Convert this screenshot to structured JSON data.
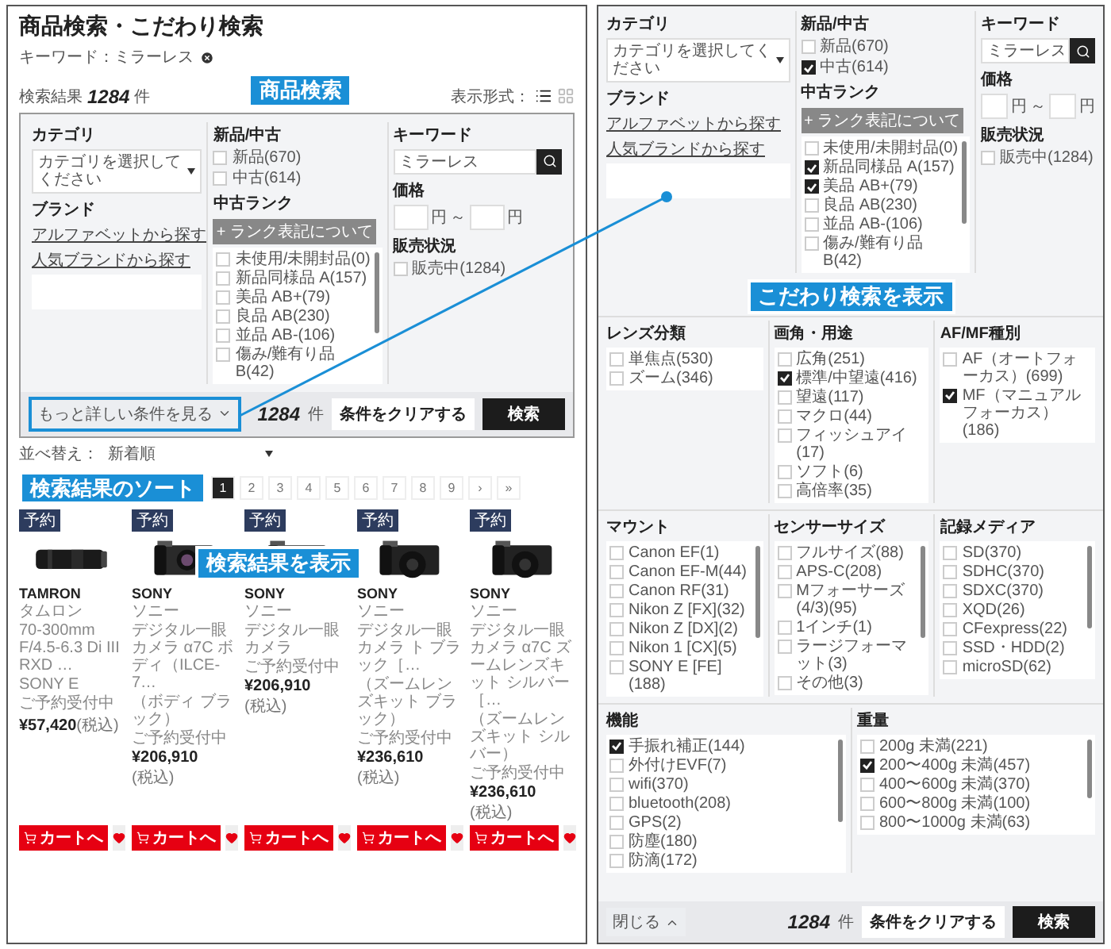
{
  "left": {
    "title": "商品検索・こだわり検索",
    "keyword_tag": "キーワード：ミラーレス",
    "result": {
      "label": "検索結果",
      "count": "1284",
      "unit": "件"
    },
    "view": {
      "label": "表示形式：",
      "modes": [
        {
          "kind": "list",
          "selected": true
        },
        {
          "kind": "grid",
          "selected": false
        }
      ]
    },
    "search": {
      "category": {
        "label": "カテゴリ",
        "placeholder": "カテゴリを選択してください"
      },
      "brand": {
        "label": "ブランド",
        "links": [
          "アルファベットから探す",
          "人気ブランドから探す"
        ]
      },
      "condition": {
        "label": "新品/中古",
        "options": [
          {
            "label": "新品(670)",
            "checked": false
          },
          {
            "label": "中古(614)",
            "checked": false
          }
        ]
      },
      "rank": {
        "label": "中古ランク",
        "help": "+ ランク表記について",
        "options": [
          {
            "label": "未使用/未開封品(0)",
            "checked": false
          },
          {
            "label": "新品同様品 A(157)",
            "checked": false
          },
          {
            "label": "美品 AB+(79)",
            "checked": false
          },
          {
            "label": "良品 AB(230)",
            "checked": false
          },
          {
            "label": "並品 AB-(106)",
            "checked": false
          },
          {
            "label": "傷み/難有り品 B(42)",
            "checked": false
          }
        ]
      },
      "keyword": {
        "label": "キーワード",
        "value": "ミラーレス"
      },
      "price": {
        "label": "価格",
        "min_unit": "円",
        "separator": "～",
        "max_unit": "円"
      },
      "status": {
        "label": "販売状況",
        "options": [
          {
            "label": "販売中(1284)",
            "checked": false
          }
        ]
      }
    },
    "footer": {
      "toggle": "もっと詳しい条件を見る",
      "expanded": false,
      "count": "1284",
      "unit": "件",
      "clear": "条件をクリアする",
      "submit": "検索"
    },
    "sort": {
      "label": "並べ替え：",
      "value": "新着順"
    },
    "pages": [
      {
        "label": "1",
        "selected": true
      },
      {
        "label": "2",
        "selected": false
      },
      {
        "label": "3",
        "selected": false
      },
      {
        "label": "4",
        "selected": false
      },
      {
        "label": "5",
        "selected": false
      },
      {
        "label": "6",
        "selected": false
      },
      {
        "label": "7",
        "selected": false
      },
      {
        "label": "8",
        "selected": false
      },
      {
        "label": "9",
        "selected": false
      },
      {
        "label": "›",
        "selected": false
      },
      {
        "label": "»",
        "selected": false
      }
    ],
    "products": [
      {
        "kind": "lens",
        "badge": "予約",
        "brand": "TAMRON",
        "brand_kana": "タムロン",
        "name": "70-300mm F/4.5-6.3 Di III RXD …",
        "note": "SONY E",
        "status": "ご予約受付中",
        "price": "¥57,420",
        "tax": "(税込)",
        "cart": "カートへ"
      },
      {
        "kind": "camera",
        "badge": "予約",
        "brand": "SONY",
        "brand_kana": "ソニー",
        "name": "デジタル一眼カメラ α7C ボディ（ILCE-7…",
        "note": "（ボディ ブラック）",
        "status": "ご予約受付中",
        "price": "¥206,910",
        "tax": "(税込)",
        "cart": "カートへ"
      },
      {
        "kind": "camera",
        "badge": "予約",
        "brand": "SONY",
        "brand_kana": "ソニー",
        "name": "デジタル一眼カメラ",
        "status": "ご予約受付中",
        "price": "¥206,910",
        "tax": "(税込)",
        "cart": "カートへ"
      },
      {
        "kind": "kit",
        "badge": "予約",
        "brand": "SONY",
        "brand_kana": "ソニー",
        "name": "デジタル一眼カメラ ト ブラック［…",
        "note": "（ズームレンズキット ブラック）",
        "status": "ご予約受付中",
        "price": "¥236,610",
        "tax": "(税込)",
        "cart": "カートへ"
      },
      {
        "kind": "kit",
        "badge": "予約",
        "brand": "SONY",
        "brand_kana": "ソニー",
        "name": "デジタル一眼カメラ α7C ズームレンズキット シルバー［…",
        "note": "（ズームレンズキット シルバー）",
        "status": "ご予約受付中",
        "price": "¥236,610",
        "tax": "(税込)",
        "cart": "カートへ"
      }
    ]
  },
  "right": {
    "search": {
      "category": {
        "label": "カテゴリ",
        "placeholder": "カテゴリを選択してください"
      },
      "brand": {
        "label": "ブランド",
        "links": [
          "アルファベットから探す",
          "人気ブランドから探す"
        ]
      },
      "condition": {
        "label": "新品/中古",
        "options": [
          {
            "label": "新品(670)",
            "checked": false
          },
          {
            "label": "中古(614)",
            "checked": true
          }
        ]
      },
      "rank": {
        "label": "中古ランク",
        "help": "+ ランク表記について",
        "options": [
          {
            "label": "未使用/未開封品(0)",
            "checked": false
          },
          {
            "label": "新品同様品 A(157)",
            "checked": true
          },
          {
            "label": "美品 AB+(79)",
            "checked": true
          },
          {
            "label": "良品 AB(230)",
            "checked": false
          },
          {
            "label": "並品 AB-(106)",
            "checked": false
          },
          {
            "label": "傷み/難有り品 B(42)",
            "checked": false
          }
        ]
      },
      "keyword": {
        "label": "キーワード",
        "value": "ミラーレス"
      },
      "price": {
        "label": "価格",
        "min_unit": "円",
        "separator": "～",
        "max_unit": "円"
      },
      "status": {
        "label": "販売状況",
        "options": [
          {
            "label": "販売中(1284)",
            "checked": false
          }
        ]
      }
    },
    "groups": [
      [
        {
          "label": "レンズ分類",
          "options": [
            {
              "label": "単焦点(530)",
              "checked": false
            },
            {
              "label": "ズーム(346)",
              "checked": false
            }
          ]
        },
        {
          "label": "画角・用途",
          "options": [
            {
              "label": "広角(251)",
              "checked": false
            },
            {
              "label": "標準/中望遠(416)",
              "checked": true
            },
            {
              "label": "望遠(117)",
              "checked": false
            },
            {
              "label": "マクロ(44)",
              "checked": false
            },
            {
              "label": "フィッシュアイ(17)",
              "checked": false
            },
            {
              "label": "ソフト(6)",
              "checked": false
            },
            {
              "label": "高倍率(35)",
              "checked": false
            }
          ]
        },
        {
          "label": "AF/MF種別",
          "options": [
            {
              "label": "AF（オートフォーカス）(699)",
              "checked": false
            },
            {
              "label": "MF（マニュアルフォーカス）(186)",
              "checked": true
            }
          ]
        }
      ],
      [
        {
          "label": "マウント",
          "options": [
            {
              "label": "Canon EF(1)",
              "checked": false
            },
            {
              "label": "Canon EF-M(44)",
              "checked": false
            },
            {
              "label": "Canon RF(31)",
              "checked": false
            },
            {
              "label": "Nikon Z [FX](32)",
              "checked": false
            },
            {
              "label": "Nikon Z [DX](2)",
              "checked": false
            },
            {
              "label": "Nikon 1 [CX](5)",
              "checked": false
            },
            {
              "label": "SONY E [FE](188)",
              "checked": false
            }
          ]
        },
        {
          "label": "センサーサイズ",
          "options": [
            {
              "label": "フルサイズ(88)",
              "checked": false
            },
            {
              "label": "APS-C(208)",
              "checked": false
            },
            {
              "label": "Mフォーサーズ(4/3)(95)",
              "checked": false
            },
            {
              "label": "1インチ(1)",
              "checked": false
            },
            {
              "label": "ラージフォーマット(3)",
              "checked": false
            },
            {
              "label": "その他(3)",
              "checked": false
            }
          ]
        },
        {
          "label": "記録メディア",
          "options": [
            {
              "label": "SD(370)",
              "checked": false
            },
            {
              "label": "SDHC(370)",
              "checked": false
            },
            {
              "label": "SDXC(370)",
              "checked": false
            },
            {
              "label": "XQD(26)",
              "checked": false
            },
            {
              "label": "CFexpress(22)",
              "checked": false
            },
            {
              "label": "SSD・HDD(2)",
              "checked": false
            },
            {
              "label": "microSD(62)",
              "checked": false
            }
          ]
        }
      ],
      [
        {
          "label": "機能",
          "options": [
            {
              "label": "手振れ補正(144)",
              "checked": true
            },
            {
              "label": "外付けEVF(7)",
              "checked": false
            },
            {
              "label": "wifi(370)",
              "checked": false
            },
            {
              "label": "bluetooth(208)",
              "checked": false
            },
            {
              "label": "GPS(2)",
              "checked": false
            },
            {
              "label": "防塵(180)",
              "checked": false
            },
            {
              "label": "防滴(172)",
              "checked": false
            }
          ]
        },
        {
          "label": "重量",
          "options": [
            {
              "label": "200g 未満(221)",
              "checked": false
            },
            {
              "label": "200〜400g 未満(457)",
              "checked": true
            },
            {
              "label": "400〜600g 未満(370)",
              "checked": false
            },
            {
              "label": "600〜800g 未満(100)",
              "checked": false
            },
            {
              "label": "800〜1000g 未満(63)",
              "checked": false
            }
          ]
        }
      ]
    ],
    "footer": {
      "toggle": "閉じる",
      "expanded": true,
      "count": "1284",
      "unit": "件",
      "clear": "条件をクリアする",
      "submit": "検索"
    }
  },
  "callouts": [
    "商品検索",
    "検索結果のソート",
    "検索結果を表示",
    "こだわり検索を表示"
  ]
}
